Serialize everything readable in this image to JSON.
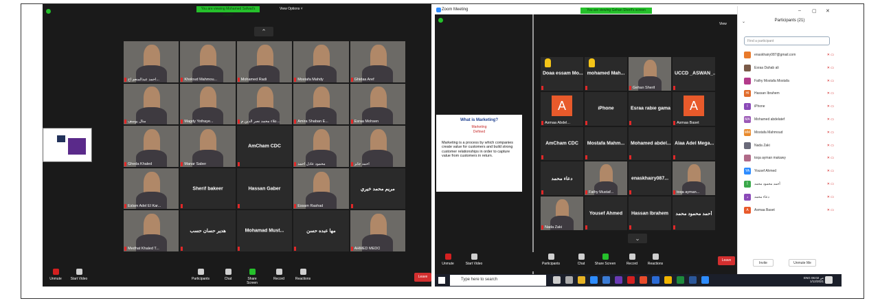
{
  "left": {
    "banner": "You are viewing Mohamed Safwat's screen",
    "view_options": "View Options ˅",
    "tiles": [
      {
        "name": "احمد عبدالمنعم اح...",
        "kind": "video"
      },
      {
        "name": "Kholoud Mahmou...",
        "kind": "video"
      },
      {
        "name": "Mohamed Radi",
        "kind": "video"
      },
      {
        "name": "Mostafa Mahdy",
        "kind": "video"
      },
      {
        "name": "Ghidaa Aref",
        "kind": "video"
      },
      {
        "name": "منال يوسف",
        "kind": "video"
      },
      {
        "name": "Magdy Yothaye...",
        "kind": "video"
      },
      {
        "name": "علاء محمد نصر الدين م...",
        "kind": "video"
      },
      {
        "name": "Amira Shaban E...",
        "kind": "video"
      },
      {
        "name": "Esraa Mohsen",
        "kind": "video"
      },
      {
        "name": "Gheda Khaled",
        "kind": "video"
      },
      {
        "name": "Manar Saber",
        "kind": "video"
      },
      {
        "name": "",
        "kind": "text",
        "label": "AmCham CDC"
      },
      {
        "name": "محمود عادل احمد",
        "kind": "video"
      },
      {
        "name": "احمد جابر",
        "kind": "video"
      },
      {
        "name": "Eslam Adel El Kar...",
        "kind": "video"
      },
      {
        "name": "",
        "kind": "text",
        "label": "Sherif bakeer"
      },
      {
        "name": "",
        "kind": "text",
        "label": "Hassan Gaber"
      },
      {
        "name": "Essam Rashad",
        "kind": "video"
      },
      {
        "name": "",
        "kind": "text",
        "label": "مريم محمد خيري"
      },
      {
        "name": "Medhat Khaled T...",
        "kind": "video"
      },
      {
        "name": "",
        "kind": "text",
        "label": "هدير حسان حسب"
      },
      {
        "name": "",
        "kind": "text",
        "label": "Mohamad Must..."
      },
      {
        "name": "",
        "kind": "text",
        "label": "مها عبده حسن"
      },
      {
        "name": "AHMED MEDO",
        "kind": "video"
      }
    ],
    "toolbar": {
      "unmute": "Unmute",
      "start_video": "Start Video",
      "participants": "Participants",
      "participants_count": "21",
      "chat": "Chat",
      "share_screen": "Share Screen",
      "record": "Record",
      "reactions": "Reactions",
      "leave": "Leave"
    }
  },
  "right": {
    "window_title": "Zoom Meeting",
    "view_label": "View",
    "banner": "You are viewing Gehan Sherif's screen",
    "view_options": "View Options ˅",
    "slide": {
      "title": "What is Marketing?",
      "sub1": "Marketing",
      "sub2": "Defined",
      "body": "Marketing is a process by which companies create value for customers and build strong customer relationships in order to capture value from customers in return."
    },
    "tiles": [
      {
        "label": "Doaa essam Mo...",
        "kind": "text",
        "hand": true
      },
      {
        "label": "mohamed Mah...",
        "kind": "text",
        "hand": true
      },
      {
        "label": "",
        "name": "Gehan Sherif",
        "kind": "video"
      },
      {
        "label": "UCCD _ASWAN_...",
        "kind": "text"
      },
      {
        "label": "",
        "name": "Asmaa Abdel...",
        "kind": "letter",
        "letter": "A"
      },
      {
        "label": "iPhone",
        "kind": "text"
      },
      {
        "label": "Esraa rabie gama",
        "kind": "text"
      },
      {
        "label": "",
        "name": "Asmaa Baset",
        "kind": "letter",
        "letter": "A"
      },
      {
        "label": "AmCham CDC",
        "kind": "text"
      },
      {
        "label": "Mostafa Mahm...",
        "kind": "text"
      },
      {
        "label": "Mohamed abdel...",
        "kind": "text"
      },
      {
        "label": "Alaa Adel Mega...",
        "kind": "text"
      },
      {
        "label": "دعاء محمد",
        "kind": "text"
      },
      {
        "label": "",
        "name": "Fathy Mustaf...",
        "kind": "video"
      },
      {
        "label": "enaskhairy087...",
        "kind": "text"
      },
      {
        "label": "",
        "name": "toqa ayman...",
        "kind": "video"
      },
      {
        "label": "",
        "name": "Nada Zaki",
        "kind": "video"
      },
      {
        "label": "Yousef Ahmed",
        "kind": "text"
      },
      {
        "label": "Hassan Ibrahem",
        "kind": "text"
      },
      {
        "label": "أحمد محمود محمد",
        "kind": "text"
      }
    ],
    "toolbar": {
      "unmute": "Unmute",
      "start_video": "Start Video",
      "participants": "Participants",
      "participants_count": "21",
      "chat": "Chat",
      "share_screen": "Share Screen",
      "record": "Record",
      "reactions": "Reactions",
      "leave": "Leave"
    },
    "panel": {
      "title": "Participants (21)",
      "search_placeholder": "Find a participant",
      "invite": "Invite",
      "unmute_me": "Unmute Me",
      "people": [
        {
          "name": "enaskhairy087@gmail.com",
          "initials": "",
          "color": "#e87a2b"
        },
        {
          "name": "Esraa Dahab ali",
          "initials": "",
          "color": "#7a5a48"
        },
        {
          "name": "Fathy Mostafa Mostafa",
          "initials": "",
          "color": "#b33a8a"
        },
        {
          "name": "Hassan Ibrahem",
          "initials": "HI",
          "color": "#e06b2a"
        },
        {
          "name": "iPhone",
          "initials": "I",
          "color": "#8b4ab8"
        },
        {
          "name": "Mohamed abdelatef",
          "initials": "MA",
          "color": "#9b59b6"
        },
        {
          "name": "Mostafa Mahmoud",
          "initials": "MM",
          "color": "#e8892b"
        },
        {
          "name": "Nada Zaki",
          "initials": "",
          "color": "#6a6a7a"
        },
        {
          "name": "toqa ayman makawy",
          "initials": "",
          "color": "#b06a88"
        },
        {
          "name": "Yousef Ahmed",
          "initials": "YA",
          "color": "#2d8cff"
        },
        {
          "name": "أحمد محمود محمد",
          "initials": "أ",
          "color": "#3aa84a"
        },
        {
          "name": "دعاء محمد",
          "initials": "د",
          "color": "#8b4ab8"
        },
        {
          "name": "Asmaa Baset",
          "initials": "A",
          "color": "#e85a2b"
        }
      ]
    }
  },
  "taskbar": {
    "search_placeholder": "Type here to search",
    "language": "ENG",
    "time": "06:02 ص",
    "date": "1/12/2021"
  }
}
